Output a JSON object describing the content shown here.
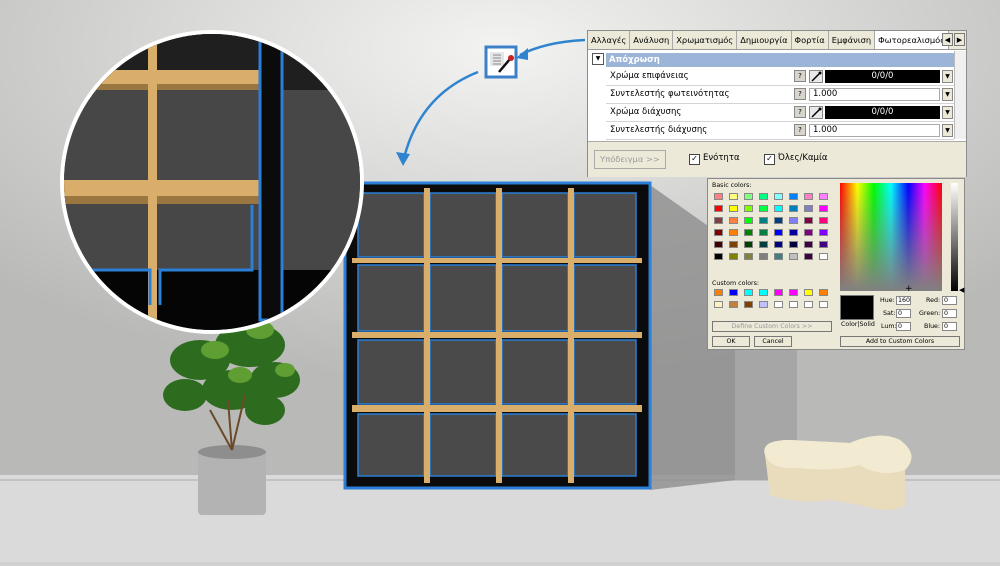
{
  "panel": {
    "tabs": [
      "Αλλαγές",
      "Ανάλυση",
      "Χρωματισμός",
      "Δημιουργία",
      "Φορτία",
      "Εμφάνιση",
      "Φωτορεαλισμός"
    ],
    "active_tab": "Φωτορεαλισμός",
    "section_title": "Απόχρωση",
    "rows": [
      {
        "label": "Χρώμα επιφάνειας",
        "value": "0/0/0"
      },
      {
        "label": "Συντελεστής φωτεινότητας",
        "value": "1.000"
      },
      {
        "label": "Χρώμα διάχυσης",
        "value": "0/0/0"
      },
      {
        "label": "Συντελεστής διάχυσης",
        "value": "1.000"
      }
    ],
    "help_label": "?",
    "example_button": "Υπόδειγμα >>",
    "unity_label": "Ενότητα",
    "all_none_label": "Όλες/Καμία"
  },
  "color_dialog": {
    "basic_label": "Basic colors:",
    "custom_label": "Custom colors:",
    "define_button": "Define Custom Colors >>",
    "ok": "OK",
    "cancel": "Cancel",
    "hue_label": "Hue:",
    "hue": "160",
    "sat_label": "Sat:",
    "sat": "0",
    "lum_label": "Lum:",
    "lum": "0",
    "red_label": "Red:",
    "red": "0",
    "green_label": "Green:",
    "green": "0",
    "blue_label": "Blue:",
    "blue": "0",
    "colorsolid_label": "Color|Solid",
    "add_button": "Add to Custom Colors",
    "basic_colors": [
      "#ff8080",
      "#ffff80",
      "#80ff80",
      "#00ff80",
      "#80ffff",
      "#0080ff",
      "#ff80c0",
      "#ff80ff",
      "#ff0000",
      "#ffff00",
      "#80ff00",
      "#00ff40",
      "#00ffff",
      "#0080c0",
      "#8080c0",
      "#ff00ff",
      "#804040",
      "#ff8040",
      "#00ff00",
      "#008080",
      "#004080",
      "#8080ff",
      "#800040",
      "#ff0080",
      "#800000",
      "#ff8000",
      "#008000",
      "#008040",
      "#0000ff",
      "#0000a0",
      "#800080",
      "#8000ff",
      "#400000",
      "#804000",
      "#004000",
      "#004040",
      "#000080",
      "#000040",
      "#400040",
      "#400080",
      "#000000",
      "#808000",
      "#808040",
      "#808080",
      "#408080",
      "#c0c0c0",
      "#400040",
      "#ffffff"
    ],
    "custom_colors": [
      "#ff8000",
      "#0000ff",
      "#00ffff",
      "#00ffff",
      "#ff00ff",
      "#ff00ff",
      "#ffff00",
      "#ff8000",
      "#fff0c0",
      "#c08040",
      "#804000",
      "#c0c0ff",
      "#ffffff",
      "#ffffff",
      "#ffffff",
      "#ffffff"
    ]
  }
}
